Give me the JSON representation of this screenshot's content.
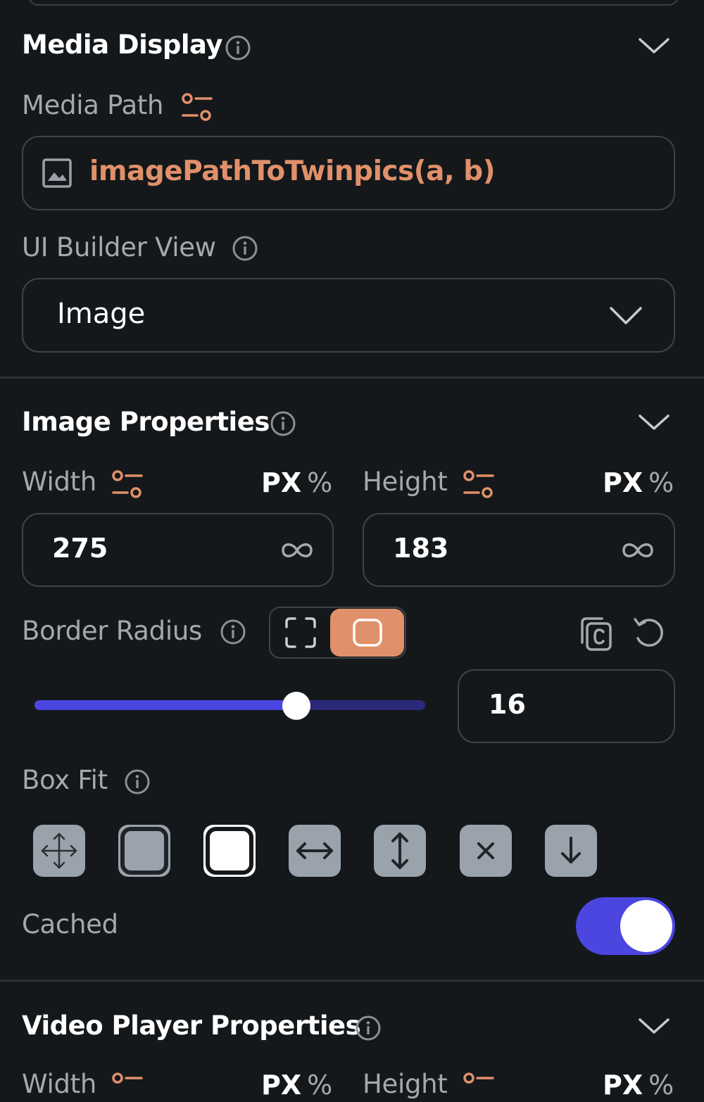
{
  "media_display": {
    "title": "Media Display",
    "media_path_label": "Media Path",
    "media_path_value": "imagePathToTwinpics(a, b)",
    "ui_builder_view_label": "UI Builder View",
    "ui_builder_view_value": "Image"
  },
  "image_properties": {
    "title": "Image Properties",
    "width_label": "Width",
    "height_label": "Height",
    "unit_px": "PX",
    "unit_percent": "%",
    "width_value": "275",
    "height_value": "183",
    "border_radius_label": "Border Radius",
    "border_radius_value": "16",
    "border_radius_slider_fraction": 0.67,
    "box_fit_label": "Box Fit",
    "box_fit_options": [
      "fill",
      "contain",
      "cover",
      "fit-width",
      "fit-height",
      "none",
      "scale-down"
    ],
    "box_fit_selected": "cover",
    "cached_label": "Cached",
    "cached_on": true
  },
  "video_player_properties": {
    "title": "Video Player Properties"
  },
  "colors": {
    "background": "#14181b",
    "accent_orange": "#e0906a",
    "accent_blue": "#4b46e0"
  }
}
